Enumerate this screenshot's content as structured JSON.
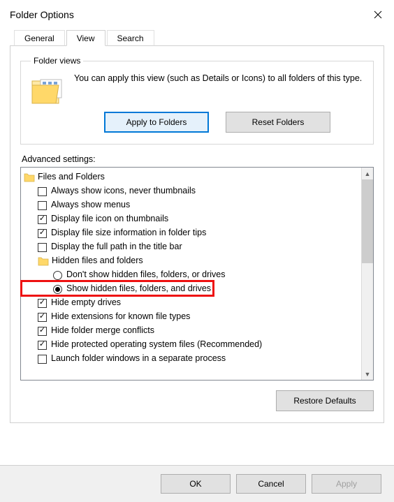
{
  "window": {
    "title": "Folder Options"
  },
  "tabs": {
    "general": "General",
    "view": "View",
    "search": "Search",
    "active": "view"
  },
  "folderViews": {
    "legend": "Folder views",
    "text": "You can apply this view (such as Details or Icons) to all folders of this type.",
    "apply": "Apply to Folders",
    "reset": "Reset Folders"
  },
  "advanced": {
    "label": "Advanced settings:",
    "root": "Files and Folders",
    "items": [
      {
        "type": "checkbox",
        "checked": false,
        "label": "Always show icons, never thumbnails"
      },
      {
        "type": "checkbox",
        "checked": false,
        "label": "Always show menus"
      },
      {
        "type": "checkbox",
        "checked": true,
        "label": "Display file icon on thumbnails"
      },
      {
        "type": "checkbox",
        "checked": true,
        "label": "Display file size information in folder tips"
      },
      {
        "type": "checkbox",
        "checked": false,
        "label": "Display the full path in the title bar"
      },
      {
        "type": "folder",
        "label": "Hidden files and folders"
      },
      {
        "type": "radio",
        "indent": 2,
        "selected": false,
        "label": "Don't show hidden files, folders, or drives"
      },
      {
        "type": "radio",
        "indent": 2,
        "selected": true,
        "label": "Show hidden files, folders, and drives",
        "highlight": true
      },
      {
        "type": "checkbox",
        "checked": true,
        "label": "Hide empty drives"
      },
      {
        "type": "checkbox",
        "checked": true,
        "label": "Hide extensions for known file types"
      },
      {
        "type": "checkbox",
        "checked": true,
        "label": "Hide folder merge conflicts"
      },
      {
        "type": "checkbox",
        "checked": true,
        "label": "Hide protected operating system files (Recommended)"
      },
      {
        "type": "checkbox",
        "checked": false,
        "label": "Launch folder windows in a separate process",
        "cut": true
      }
    ]
  },
  "restore": "Restore Defaults",
  "buttons": {
    "ok": "OK",
    "cancel": "Cancel",
    "apply": "Apply"
  }
}
